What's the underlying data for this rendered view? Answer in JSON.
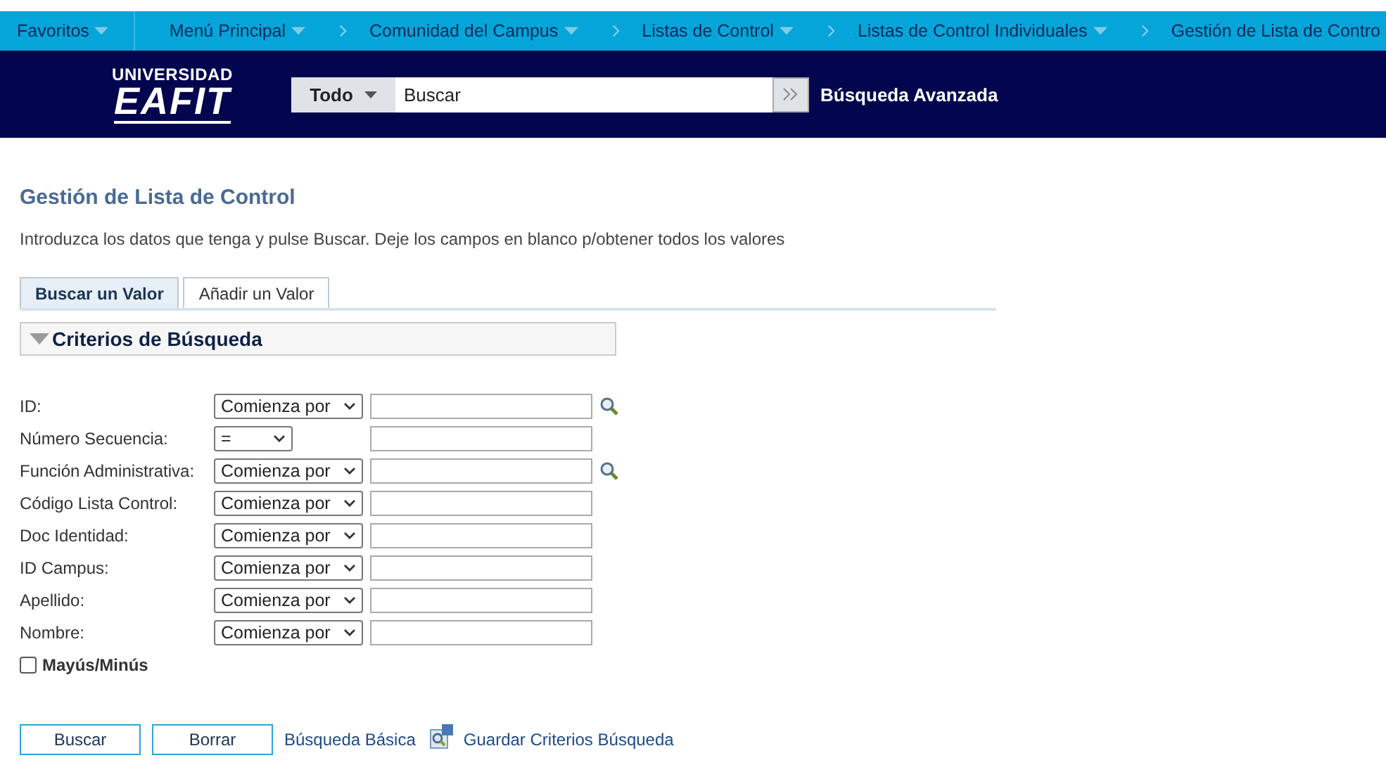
{
  "nav": [
    {
      "label": "Favoritos",
      "dropdown": true,
      "chevron_before": false
    },
    {
      "label": "Menú Principal",
      "dropdown": true,
      "chevron_before": false
    },
    {
      "label": "Comunidad del Campus",
      "dropdown": true,
      "chevron_before": true
    },
    {
      "label": "Listas de Control",
      "dropdown": true,
      "chevron_before": true
    },
    {
      "label": "Listas de Control Individuales",
      "dropdown": true,
      "chevron_before": true
    },
    {
      "label": "Gestión de Lista de Contro",
      "dropdown": false,
      "chevron_before": true
    }
  ],
  "header": {
    "logo_top": "UNIVERSIDAD",
    "logo_main": "EAFIT",
    "scope": "Todo",
    "search_placeholder": "Buscar",
    "advanced_link": "Búsqueda Avanzada"
  },
  "page_title": "Gestión de Lista de Control",
  "instructions": "Introduzca los datos que tenga y pulse Buscar. Deje los campos en blanco p/obtener todos los valores",
  "tabs": [
    {
      "label": "Buscar un Valor",
      "selected": true
    },
    {
      "label": "Añadir un Valor",
      "selected": false
    }
  ],
  "section": {
    "title": "Criterios de Búsqueda",
    "expanded": true
  },
  "fields": [
    {
      "label": "ID:",
      "operator": "Comienza por",
      "lookup": true
    },
    {
      "label": "Número Secuencia:",
      "operator": "=",
      "lookup": false
    },
    {
      "label": "Función Administrativa:",
      "operator": "Comienza por",
      "lookup": true
    },
    {
      "label": "Código Lista Control:",
      "operator": "Comienza por",
      "lookup": false
    },
    {
      "label": "Doc Identidad:",
      "operator": "Comienza por",
      "lookup": false
    },
    {
      "label": "ID Campus:",
      "operator": "Comienza por",
      "lookup": false
    },
    {
      "label": "Apellido:",
      "operator": "Comienza por",
      "lookup": false
    },
    {
      "label": "Nombre:",
      "operator": "Comienza por",
      "lookup": false
    }
  ],
  "case_sensitive": {
    "label": "Mayús/Minús",
    "checked": false
  },
  "buttons": [
    "Buscar",
    "Borrar"
  ],
  "links": [
    {
      "label": "Búsqueda Básica",
      "icon": false
    },
    {
      "label": "Guardar Criterios Búsqueda",
      "icon": true
    }
  ]
}
